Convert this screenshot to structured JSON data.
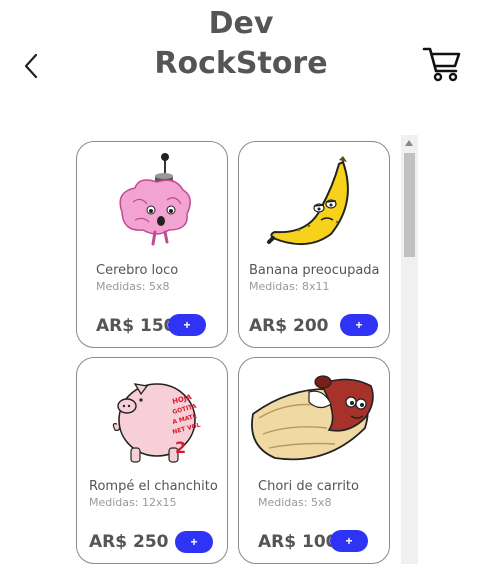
{
  "header": {
    "title_line1": "Dev",
    "title_line2": "RockStore",
    "back_icon": "chevron-left-icon",
    "cart_icon": "shopping-cart-icon"
  },
  "products": [
    {
      "name": "Cerebro loco",
      "measures": "Medidas: 5x8",
      "price": "AR$ 150",
      "button": "+",
      "icon": "brain-sticker"
    },
    {
      "name": "Banana preocupada",
      "measures": "Medidas: 8x11",
      "price": "AR$ 200",
      "button": "+",
      "icon": "banana-sticker"
    },
    {
      "name": "Rompé el chanchito",
      "measures": "Medidas: 12x15",
      "price": "AR$ 250",
      "button": "+",
      "icon": "piggy-bank-sticker",
      "art_text": "Hoja gotita a mate net vol 2"
    },
    {
      "name": "Chori de carrito",
      "measures": "Medidas: 5x8",
      "price": "AR$ 100",
      "button": "+",
      "icon": "choripan-sticker"
    }
  ],
  "colors": {
    "accent": "#2f33f5",
    "text": "#555555",
    "muted": "#999999",
    "border": "#8a8a8a"
  }
}
